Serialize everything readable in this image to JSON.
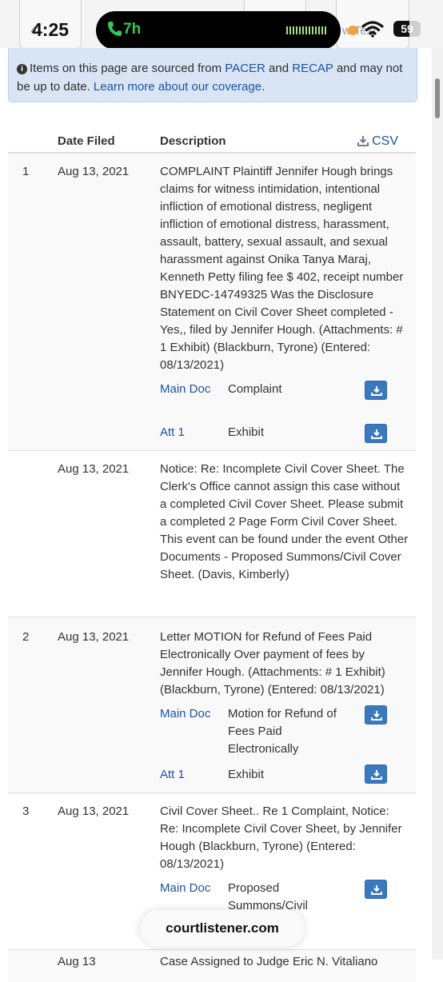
{
  "status_bar": {
    "time": "4:25",
    "call_duration": "7h",
    "battery": "59",
    "battery_fraction": 0.59
  },
  "toolbar": {
    "left_text": "4",
    "right_text": "w Text"
  },
  "notice": {
    "text": "Items on this page are sourced from ",
    "pacer_link": "PACER",
    "and_text": " and ",
    "recap_link": "RECAP",
    "tail_text": " and may not be up to date. ",
    "coverage_link": "Learn more about our coverage"
  },
  "table": {
    "headers": {
      "date": "Date Filed",
      "description": "Description",
      "csv": "CSV"
    },
    "entries": [
      {
        "number": "1",
        "date": "Aug 13, 2021",
        "description": "COMPLAINT Plaintiff Jennifer Hough brings claims for witness intimidation, intentional infliction of emotional distress, negligent infliction of emotional distress, harassment, assault, battery, sexual assault, and sexual harassment against Onika Tanya Maraj, Kenneth Petty filing fee $ 402, receipt number BNYEDC-14749325 Was the Disclosure Statement on Civil Cover Sheet completed -Yes,, filed by Jennifer Hough. (Attachments: # 1 Exhibit) (Blackburn, Tyrone) (Entered: 08/13/2021)",
        "documents": [
          {
            "link": "Main Doc",
            "description": "Complaint"
          },
          {
            "link": "Att 1",
            "description": "Exhibit"
          }
        ]
      },
      {
        "number": "",
        "date": "Aug 13, 2021",
        "description": "Notice: Re: Incomplete Civil Cover Sheet. The Clerk's Office cannot assign this case without a completed Civil Cover Sheet. Please submit a completed 2 Page Form Civil Cover Sheet. This event can be found under the event Other Documents - Proposed Summons/Civil Cover Sheet. (Davis, Kimberly)",
        "documents": []
      },
      {
        "number": "2",
        "date": "Aug 13, 2021",
        "description": "Letter MOTION for Refund of Fees Paid Electronically Over payment of fees by Jennifer Hough. (Attachments: # 1 Exhibit) (Blackburn, Tyrone) (Entered: 08/13/2021)",
        "documents": [
          {
            "link": "Main Doc",
            "description": "Motion for Refund of Fees Paid Electronically"
          },
          {
            "link": "Att 1",
            "description": "Exhibit"
          }
        ]
      },
      {
        "number": "3",
        "date": "Aug 13, 2021",
        "description": "Civil Cover Sheet.. Re 1 Complaint, Notice: Re: Incomplete Civil Cover Sheet, by Jennifer Hough (Blackburn, Tyrone) (Entered: 08/13/2021)",
        "documents": [
          {
            "link": "Main Doc",
            "description": "Proposed Summons/Civil"
          }
        ]
      },
      {
        "number": "",
        "date": "Aug 13",
        "description": "Case Assigned to Judge Eric N. Vitaliano",
        "documents": []
      }
    ]
  },
  "domain": "courtlistener.com",
  "colors": {
    "link": "#1d53a4",
    "notice_bg": "#d9e5f5",
    "button": "#3979be",
    "call_green": "#34c759"
  },
  "icons": [
    "phone-icon",
    "wifi-icon",
    "info-icon",
    "download-icon"
  ]
}
